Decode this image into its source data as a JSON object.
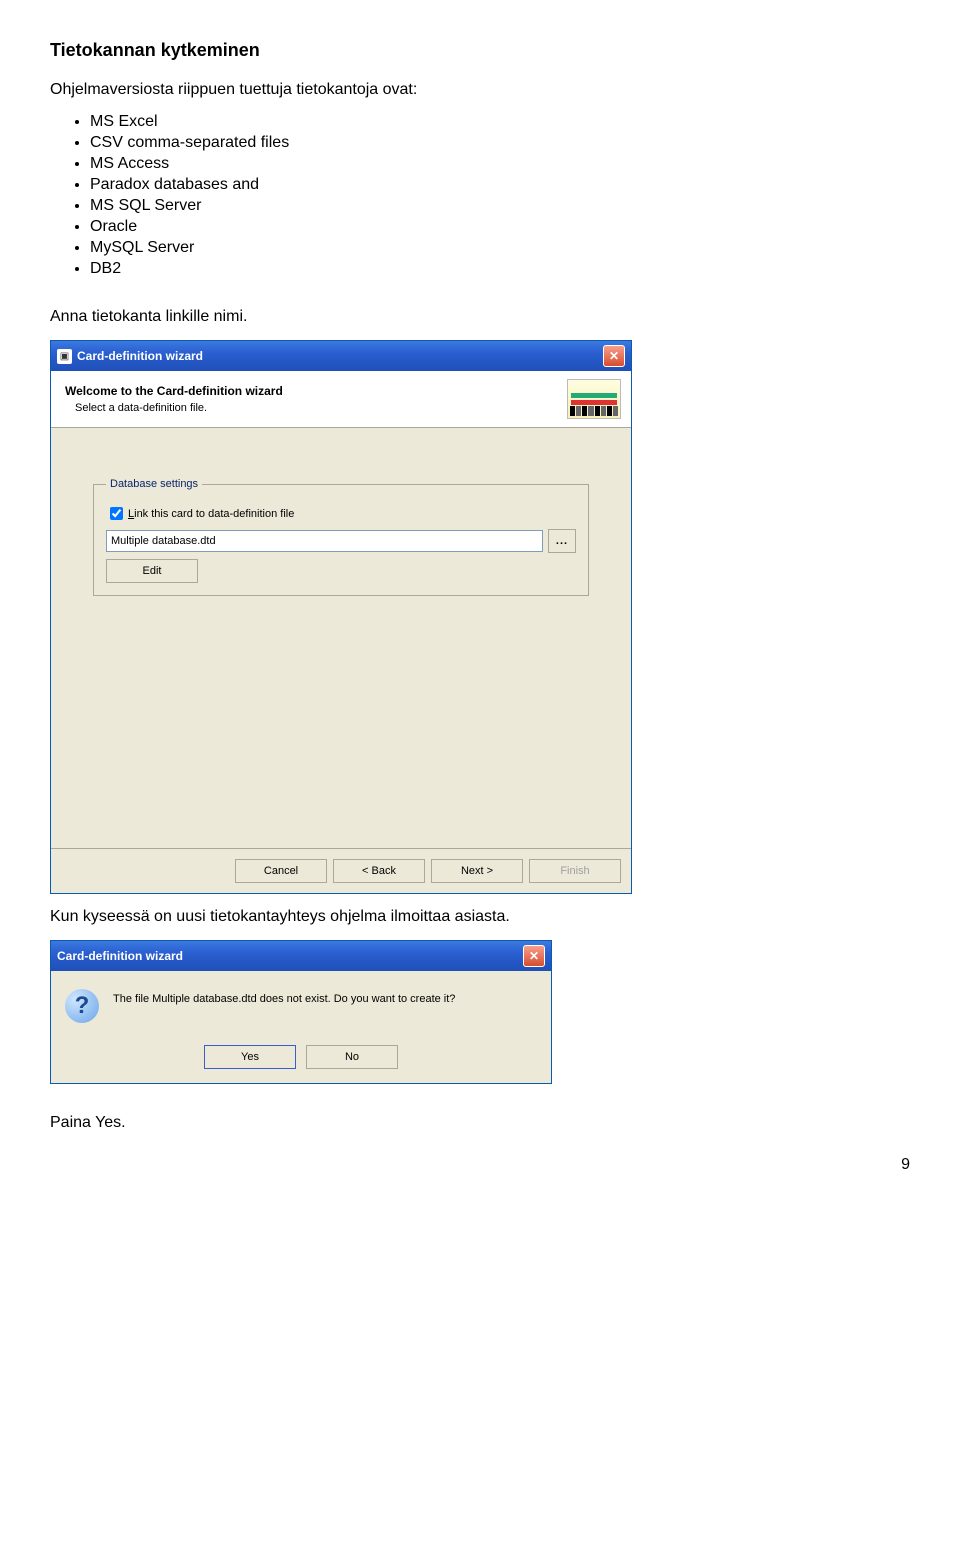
{
  "doc": {
    "heading": "Tietokannan kytkeminen",
    "intro": "Ohjelmaversiosta riippuen tuettuja tietokantoja ovat:",
    "list": [
      "MS Excel",
      "CSV comma-separated files",
      "MS Access",
      "Paradox databases and",
      "MS SQL Server",
      "Oracle",
      "MySQL Server",
      "DB2"
    ],
    "step1": "Anna tietokanta linkille nimi.",
    "step2": "Kun kyseessä on uusi tietokantayhteys ohjelma ilmoittaa asiasta.",
    "step3": "Paina Yes.",
    "page": "9"
  },
  "wizard": {
    "title": "Card-definition wizard",
    "banner_heading": "Welcome to the Card-definition wizard",
    "banner_sub": "Select a data-definition file.",
    "fieldset_legend": "Database settings",
    "chk_label_pre": "L",
    "chk_label_rest": "ink this card to data-definition file",
    "file_value": "Multiple database.dtd",
    "browse": "...",
    "edit_pre": "E",
    "edit_rest": "dit",
    "cancel_pre": "C",
    "cancel_rest": "ancel",
    "back_pre": "B",
    "back_rest": "ack",
    "back_prefix": "< ",
    "next_pre": "N",
    "next_rest": "ext >",
    "finish_pre": "F",
    "finish_rest": "inish"
  },
  "confirm": {
    "title": "Card-definition wizard",
    "msg": "The file Multiple database.dtd does not exist. Do you want to create it?",
    "yes_pre": "Y",
    "yes_rest": "es",
    "no_pre": "N",
    "no_rest": "o"
  }
}
